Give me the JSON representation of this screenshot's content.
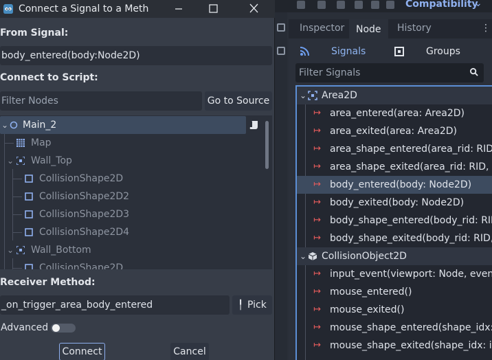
{
  "dialog": {
    "title": "Connect a Signal to a Meth...",
    "from_signal_label": "From Signal:",
    "from_signal_value": "body_entered(body:Node2D)",
    "connect_to_script_label": "Connect to Script:",
    "filter_nodes_placeholder": "Filter Nodes",
    "go_to_source_label": "Go to Source",
    "nodes": [
      {
        "label": "Main_2",
        "icon": "node2d-circle-icon"
      },
      {
        "label": "Map",
        "icon": "tilemap-icon"
      },
      {
        "label": "Wall_Top",
        "icon": "area2d-icon"
      },
      {
        "label": "CollisionShape2D",
        "icon": "collision-shape-icon"
      },
      {
        "label": "CollisionShape2D2",
        "icon": "collision-shape-icon"
      },
      {
        "label": "CollisionShape2D3",
        "icon": "collision-shape-icon"
      },
      {
        "label": "CollisionShape2D4",
        "icon": "collision-shape-icon"
      },
      {
        "label": "Wall_Bottom",
        "icon": "area2d-icon"
      },
      {
        "label": "CollisionShape2D",
        "icon": "collision-shape-icon"
      }
    ],
    "receiver_method_label": "Receiver Method:",
    "receiver_method_value": "_on_trigger_area_body_entered",
    "pick_label": "Pick",
    "advanced_label": "Advanced",
    "advanced_on": false,
    "connect_label": "Connect",
    "cancel_label": "Cancel"
  },
  "editor": {
    "renderer_label": "Compatibility",
    "dock_tabs": [
      "Inspector",
      "Node",
      "History"
    ],
    "active_dock_tab": "Node",
    "signals_tab": "Signals",
    "groups_tab": "Groups",
    "filter_signals_placeholder": "Filter Signals",
    "signal_groups": [
      {
        "class": "Area2D",
        "signals": [
          "area_entered(area: Area2D)",
          "area_exited(area: Area2D)",
          "area_shape_entered(area_rid: RID,",
          "area_shape_exited(area_rid: RID, a",
          "body_entered(body: Node2D)",
          "body_exited(body: Node2D)",
          "body_shape_entered(body_rid: RID",
          "body_shape_exited(body_rid: RID,"
        ]
      },
      {
        "class": "CollisionObject2D",
        "signals": [
          "input_event(viewport: Node, event",
          "mouse_entered()",
          "mouse_exited()",
          "mouse_shape_entered(shape_idx:",
          "mouse_shape_exited(shape_idx: in"
        ]
      }
    ],
    "selected_signal": "body_entered(body: Node2D)"
  },
  "colors": {
    "accent": "#5c8fd6",
    "signal_arrow": "#e65c5c",
    "dialog_bg": "#373d48"
  }
}
